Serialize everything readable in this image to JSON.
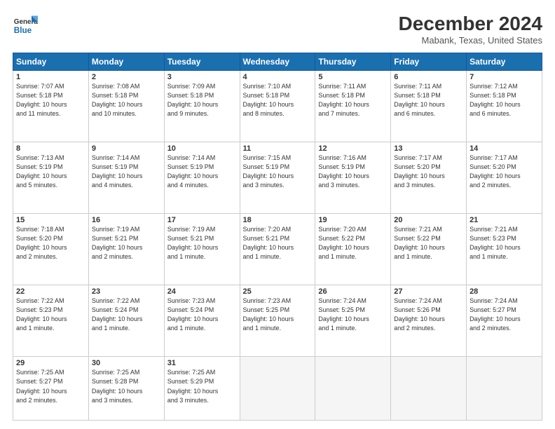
{
  "logo": {
    "text_general": "General",
    "text_blue": "Blue"
  },
  "header": {
    "month": "December 2024",
    "location": "Mabank, Texas, United States"
  },
  "days_of_week": [
    "Sunday",
    "Monday",
    "Tuesday",
    "Wednesday",
    "Thursday",
    "Friday",
    "Saturday"
  ],
  "weeks": [
    [
      {
        "day": "1",
        "info": "Sunrise: 7:07 AM\nSunset: 5:18 PM\nDaylight: 10 hours\nand 11 minutes."
      },
      {
        "day": "2",
        "info": "Sunrise: 7:08 AM\nSunset: 5:18 PM\nDaylight: 10 hours\nand 10 minutes."
      },
      {
        "day": "3",
        "info": "Sunrise: 7:09 AM\nSunset: 5:18 PM\nDaylight: 10 hours\nand 9 minutes."
      },
      {
        "day": "4",
        "info": "Sunrise: 7:10 AM\nSunset: 5:18 PM\nDaylight: 10 hours\nand 8 minutes."
      },
      {
        "day": "5",
        "info": "Sunrise: 7:11 AM\nSunset: 5:18 PM\nDaylight: 10 hours\nand 7 minutes."
      },
      {
        "day": "6",
        "info": "Sunrise: 7:11 AM\nSunset: 5:18 PM\nDaylight: 10 hours\nand 6 minutes."
      },
      {
        "day": "7",
        "info": "Sunrise: 7:12 AM\nSunset: 5:18 PM\nDaylight: 10 hours\nand 6 minutes."
      }
    ],
    [
      {
        "day": "8",
        "info": "Sunrise: 7:13 AM\nSunset: 5:19 PM\nDaylight: 10 hours\nand 5 minutes."
      },
      {
        "day": "9",
        "info": "Sunrise: 7:14 AM\nSunset: 5:19 PM\nDaylight: 10 hours\nand 4 minutes."
      },
      {
        "day": "10",
        "info": "Sunrise: 7:14 AM\nSunset: 5:19 PM\nDaylight: 10 hours\nand 4 minutes."
      },
      {
        "day": "11",
        "info": "Sunrise: 7:15 AM\nSunset: 5:19 PM\nDaylight: 10 hours\nand 3 minutes."
      },
      {
        "day": "12",
        "info": "Sunrise: 7:16 AM\nSunset: 5:19 PM\nDaylight: 10 hours\nand 3 minutes."
      },
      {
        "day": "13",
        "info": "Sunrise: 7:17 AM\nSunset: 5:20 PM\nDaylight: 10 hours\nand 3 minutes."
      },
      {
        "day": "14",
        "info": "Sunrise: 7:17 AM\nSunset: 5:20 PM\nDaylight: 10 hours\nand 2 minutes."
      }
    ],
    [
      {
        "day": "15",
        "info": "Sunrise: 7:18 AM\nSunset: 5:20 PM\nDaylight: 10 hours\nand 2 minutes."
      },
      {
        "day": "16",
        "info": "Sunrise: 7:19 AM\nSunset: 5:21 PM\nDaylight: 10 hours\nand 2 minutes."
      },
      {
        "day": "17",
        "info": "Sunrise: 7:19 AM\nSunset: 5:21 PM\nDaylight: 10 hours\nand 1 minute."
      },
      {
        "day": "18",
        "info": "Sunrise: 7:20 AM\nSunset: 5:21 PM\nDaylight: 10 hours\nand 1 minute."
      },
      {
        "day": "19",
        "info": "Sunrise: 7:20 AM\nSunset: 5:22 PM\nDaylight: 10 hours\nand 1 minute."
      },
      {
        "day": "20",
        "info": "Sunrise: 7:21 AM\nSunset: 5:22 PM\nDaylight: 10 hours\nand 1 minute."
      },
      {
        "day": "21",
        "info": "Sunrise: 7:21 AM\nSunset: 5:23 PM\nDaylight: 10 hours\nand 1 minute."
      }
    ],
    [
      {
        "day": "22",
        "info": "Sunrise: 7:22 AM\nSunset: 5:23 PM\nDaylight: 10 hours\nand 1 minute."
      },
      {
        "day": "23",
        "info": "Sunrise: 7:22 AM\nSunset: 5:24 PM\nDaylight: 10 hours\nand 1 minute."
      },
      {
        "day": "24",
        "info": "Sunrise: 7:23 AM\nSunset: 5:24 PM\nDaylight: 10 hours\nand 1 minute."
      },
      {
        "day": "25",
        "info": "Sunrise: 7:23 AM\nSunset: 5:25 PM\nDaylight: 10 hours\nand 1 minute."
      },
      {
        "day": "26",
        "info": "Sunrise: 7:24 AM\nSunset: 5:25 PM\nDaylight: 10 hours\nand 1 minute."
      },
      {
        "day": "27",
        "info": "Sunrise: 7:24 AM\nSunset: 5:26 PM\nDaylight: 10 hours\nand 2 minutes."
      },
      {
        "day": "28",
        "info": "Sunrise: 7:24 AM\nSunset: 5:27 PM\nDaylight: 10 hours\nand 2 minutes."
      }
    ],
    [
      {
        "day": "29",
        "info": "Sunrise: 7:25 AM\nSunset: 5:27 PM\nDaylight: 10 hours\nand 2 minutes."
      },
      {
        "day": "30",
        "info": "Sunrise: 7:25 AM\nSunset: 5:28 PM\nDaylight: 10 hours\nand 3 minutes."
      },
      {
        "day": "31",
        "info": "Sunrise: 7:25 AM\nSunset: 5:29 PM\nDaylight: 10 hours\nand 3 minutes."
      },
      {
        "day": "",
        "info": ""
      },
      {
        "day": "",
        "info": ""
      },
      {
        "day": "",
        "info": ""
      },
      {
        "day": "",
        "info": ""
      }
    ]
  ]
}
